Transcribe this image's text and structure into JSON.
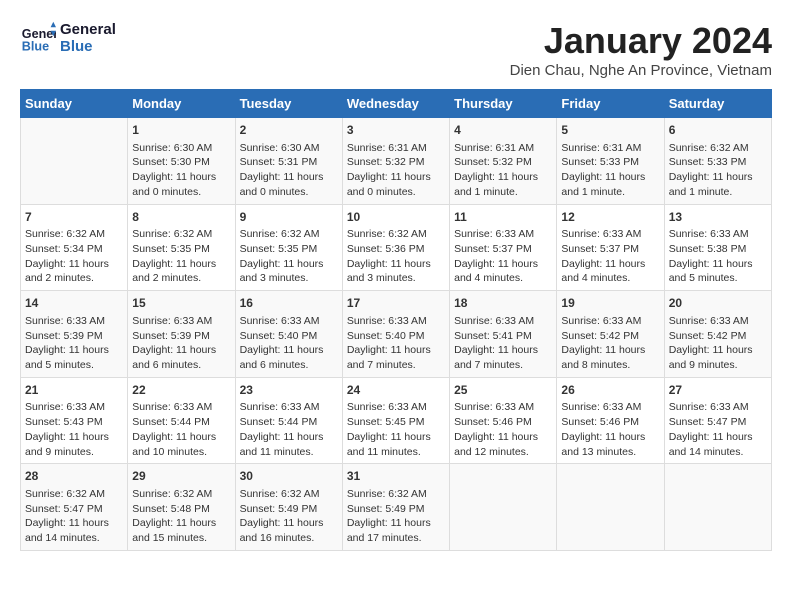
{
  "header": {
    "logo_line1": "General",
    "logo_line2": "Blue",
    "title": "January 2024",
    "subtitle": "Dien Chau, Nghe An Province, Vietnam"
  },
  "columns": [
    "Sunday",
    "Monday",
    "Tuesday",
    "Wednesday",
    "Thursday",
    "Friday",
    "Saturday"
  ],
  "weeks": [
    [
      {
        "day": "",
        "content": ""
      },
      {
        "day": "1",
        "content": "Sunrise: 6:30 AM\nSunset: 5:30 PM\nDaylight: 11 hours\nand 0 minutes."
      },
      {
        "day": "2",
        "content": "Sunrise: 6:30 AM\nSunset: 5:31 PM\nDaylight: 11 hours\nand 0 minutes."
      },
      {
        "day": "3",
        "content": "Sunrise: 6:31 AM\nSunset: 5:32 PM\nDaylight: 11 hours\nand 0 minutes."
      },
      {
        "day": "4",
        "content": "Sunrise: 6:31 AM\nSunset: 5:32 PM\nDaylight: 11 hours\nand 1 minute."
      },
      {
        "day": "5",
        "content": "Sunrise: 6:31 AM\nSunset: 5:33 PM\nDaylight: 11 hours\nand 1 minute."
      },
      {
        "day": "6",
        "content": "Sunrise: 6:32 AM\nSunset: 5:33 PM\nDaylight: 11 hours\nand 1 minute."
      }
    ],
    [
      {
        "day": "7",
        "content": "Sunrise: 6:32 AM\nSunset: 5:34 PM\nDaylight: 11 hours\nand 2 minutes."
      },
      {
        "day": "8",
        "content": "Sunrise: 6:32 AM\nSunset: 5:35 PM\nDaylight: 11 hours\nand 2 minutes."
      },
      {
        "day": "9",
        "content": "Sunrise: 6:32 AM\nSunset: 5:35 PM\nDaylight: 11 hours\nand 3 minutes."
      },
      {
        "day": "10",
        "content": "Sunrise: 6:32 AM\nSunset: 5:36 PM\nDaylight: 11 hours\nand 3 minutes."
      },
      {
        "day": "11",
        "content": "Sunrise: 6:33 AM\nSunset: 5:37 PM\nDaylight: 11 hours\nand 4 minutes."
      },
      {
        "day": "12",
        "content": "Sunrise: 6:33 AM\nSunset: 5:37 PM\nDaylight: 11 hours\nand 4 minutes."
      },
      {
        "day": "13",
        "content": "Sunrise: 6:33 AM\nSunset: 5:38 PM\nDaylight: 11 hours\nand 5 minutes."
      }
    ],
    [
      {
        "day": "14",
        "content": "Sunrise: 6:33 AM\nSunset: 5:39 PM\nDaylight: 11 hours\nand 5 minutes."
      },
      {
        "day": "15",
        "content": "Sunrise: 6:33 AM\nSunset: 5:39 PM\nDaylight: 11 hours\nand 6 minutes."
      },
      {
        "day": "16",
        "content": "Sunrise: 6:33 AM\nSunset: 5:40 PM\nDaylight: 11 hours\nand 6 minutes."
      },
      {
        "day": "17",
        "content": "Sunrise: 6:33 AM\nSunset: 5:40 PM\nDaylight: 11 hours\nand 7 minutes."
      },
      {
        "day": "18",
        "content": "Sunrise: 6:33 AM\nSunset: 5:41 PM\nDaylight: 11 hours\nand 7 minutes."
      },
      {
        "day": "19",
        "content": "Sunrise: 6:33 AM\nSunset: 5:42 PM\nDaylight: 11 hours\nand 8 minutes."
      },
      {
        "day": "20",
        "content": "Sunrise: 6:33 AM\nSunset: 5:42 PM\nDaylight: 11 hours\nand 9 minutes."
      }
    ],
    [
      {
        "day": "21",
        "content": "Sunrise: 6:33 AM\nSunset: 5:43 PM\nDaylight: 11 hours\nand 9 minutes."
      },
      {
        "day": "22",
        "content": "Sunrise: 6:33 AM\nSunset: 5:44 PM\nDaylight: 11 hours\nand 10 minutes."
      },
      {
        "day": "23",
        "content": "Sunrise: 6:33 AM\nSunset: 5:44 PM\nDaylight: 11 hours\nand 11 minutes."
      },
      {
        "day": "24",
        "content": "Sunrise: 6:33 AM\nSunset: 5:45 PM\nDaylight: 11 hours\nand 11 minutes."
      },
      {
        "day": "25",
        "content": "Sunrise: 6:33 AM\nSunset: 5:46 PM\nDaylight: 11 hours\nand 12 minutes."
      },
      {
        "day": "26",
        "content": "Sunrise: 6:33 AM\nSunset: 5:46 PM\nDaylight: 11 hours\nand 13 minutes."
      },
      {
        "day": "27",
        "content": "Sunrise: 6:33 AM\nSunset: 5:47 PM\nDaylight: 11 hours\nand 14 minutes."
      }
    ],
    [
      {
        "day": "28",
        "content": "Sunrise: 6:32 AM\nSunset: 5:47 PM\nDaylight: 11 hours\nand 14 minutes."
      },
      {
        "day": "29",
        "content": "Sunrise: 6:32 AM\nSunset: 5:48 PM\nDaylight: 11 hours\nand 15 minutes."
      },
      {
        "day": "30",
        "content": "Sunrise: 6:32 AM\nSunset: 5:49 PM\nDaylight: 11 hours\nand 16 minutes."
      },
      {
        "day": "31",
        "content": "Sunrise: 6:32 AM\nSunset: 5:49 PM\nDaylight: 11 hours\nand 17 minutes."
      },
      {
        "day": "",
        "content": ""
      },
      {
        "day": "",
        "content": ""
      },
      {
        "day": "",
        "content": ""
      }
    ]
  ]
}
